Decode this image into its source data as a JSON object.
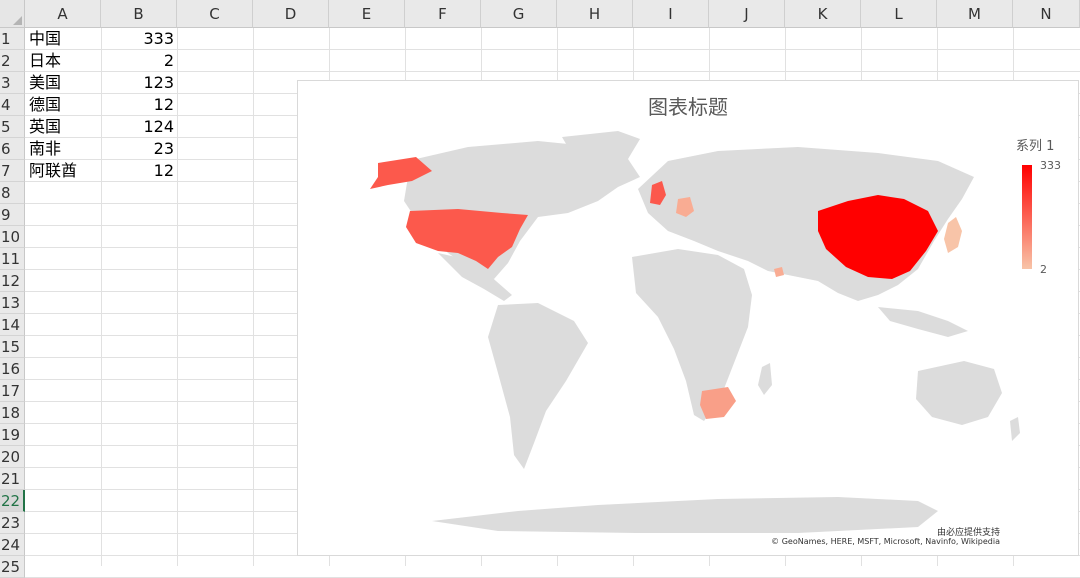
{
  "columns": [
    "A",
    "B",
    "C",
    "D",
    "E",
    "F",
    "G",
    "H",
    "I",
    "J",
    "K",
    "L",
    "M",
    "N"
  ],
  "rows": [
    "1",
    "2",
    "3",
    "4",
    "5",
    "6",
    "7",
    "8",
    "9",
    "10",
    "11",
    "12",
    "13",
    "14",
    "15",
    "16",
    "17",
    "18",
    "19",
    "20",
    "21",
    "22",
    "23",
    "24",
    "25"
  ],
  "active_row": "22",
  "table": [
    {
      "country": "中国",
      "value": "333"
    },
    {
      "country": "日本",
      "value": "2"
    },
    {
      "country": "美国",
      "value": "123"
    },
    {
      "country": "德国",
      "value": "12"
    },
    {
      "country": "英国",
      "value": "124"
    },
    {
      "country": "南非",
      "value": "23"
    },
    {
      "country": "阿联酋",
      "value": "12"
    }
  ],
  "chart": {
    "title": "图表标题",
    "legend_title": "系列 1",
    "legend_max": "333",
    "legend_min": "2",
    "credit_line1": "由必应提供支持",
    "credit_line2": "© GeoNames, HERE, MSFT, Microsoft, Navinfo, Wikipedia",
    "colors": {
      "land": "#dcdcdc",
      "high": "#ff0000",
      "low": "#f8c4a8"
    }
  },
  "chart_data": {
    "type": "map",
    "title": "图表标题",
    "legend": "系列 1",
    "scale": {
      "min": 2,
      "max": 333
    },
    "regions": [
      {
        "name": "中国",
        "value": 333
      },
      {
        "name": "日本",
        "value": 2
      },
      {
        "name": "美国",
        "value": 123
      },
      {
        "name": "德国",
        "value": 12
      },
      {
        "name": "英国",
        "value": 124
      },
      {
        "name": "南非",
        "value": 23
      },
      {
        "name": "阿联酋",
        "value": 12
      }
    ]
  }
}
